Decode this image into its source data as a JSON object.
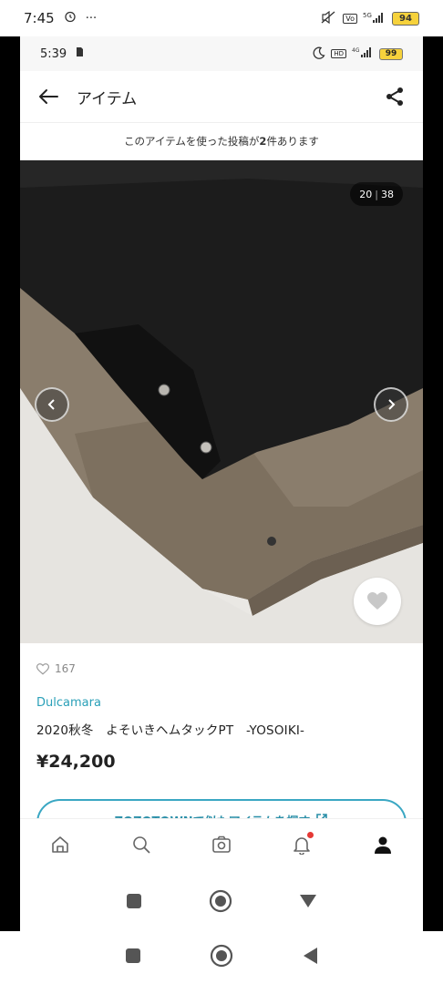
{
  "outer_status": {
    "time": "7:45",
    "battery": "94",
    "icons": [
      "alarm-icon",
      "more-icon",
      "mute-icon",
      "volte-icon",
      "5g-signal-icon",
      "battery-icon"
    ]
  },
  "inner_status": {
    "time": "5:39",
    "battery": "99",
    "network": "4G"
  },
  "header": {
    "title": "アイテム",
    "back_icon": "arrow-left-icon",
    "share_icon": "share-icon"
  },
  "notice": {
    "text_prefix": "このアイテムを使った投稿が",
    "count": "2",
    "text_suffix": "件あります"
  },
  "gallery": {
    "current": "20",
    "total": "38",
    "colors": {
      "dark_fabric": "#1c1c1c",
      "beige_fabric": "#8a7d6c",
      "background": "#e6e4e0"
    }
  },
  "item": {
    "likes": "167",
    "brand": "Dulcamara",
    "name": "2020秋冬　よそいきヘムタックPT　-YOSOIKI-",
    "price": "¥24,200",
    "zozo_button": "ZOZOTOWNで似たアイテムを探す"
  },
  "tabbar": {
    "tabs": [
      "home-icon",
      "search-icon",
      "camera-icon",
      "bell-icon",
      "user-icon"
    ],
    "accent": "#3aa7c3",
    "notification_color": "#e53935"
  }
}
